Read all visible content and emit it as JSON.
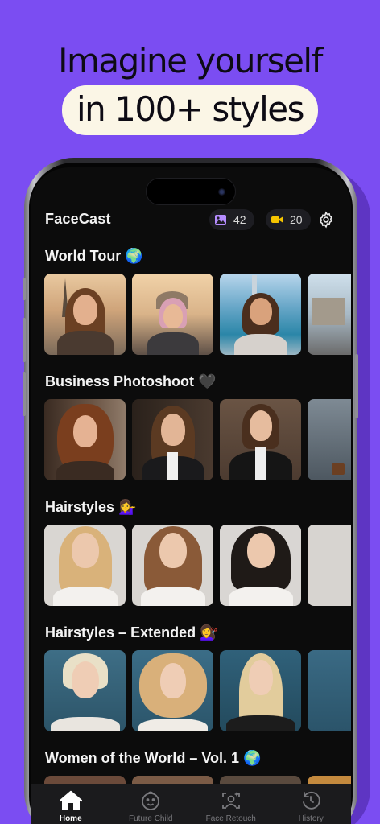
{
  "headline": {
    "line1": "Imagine yourself",
    "line2": "in 100+ styles"
  },
  "app": {
    "title": "FaceCast",
    "photo_credits": "42",
    "video_credits": "20",
    "colors": {
      "background": "#0c0c0c",
      "accent_photo": "#b58cff",
      "accent_video": "#f5c400",
      "brand_purple": "#7b4df2"
    }
  },
  "sections": [
    {
      "title": "World Tour 🌍"
    },
    {
      "title": "Business Photoshoot 🖤"
    },
    {
      "title": "Hairstyles 💁‍♀️"
    },
    {
      "title": "Hairstyles – Extended 💇‍♀️"
    },
    {
      "title": "Women of the World – Vol. 1 🌍"
    }
  ],
  "tabs": [
    {
      "label": "Home",
      "icon": "home-icon",
      "active": true
    },
    {
      "label": "Future Child",
      "icon": "baby-face-icon",
      "active": false
    },
    {
      "label": "Face Retouch",
      "icon": "face-retouch-icon",
      "active": false
    },
    {
      "label": "History",
      "icon": "history-icon",
      "active": false
    }
  ]
}
